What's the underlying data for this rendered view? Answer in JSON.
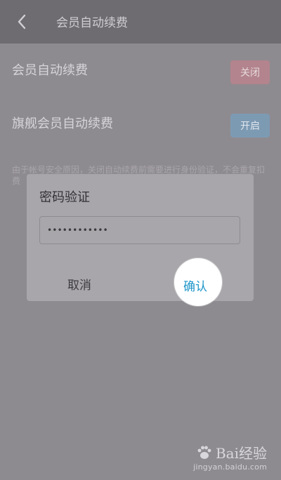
{
  "header": {
    "title": "会员自动续费",
    "back_icon": "chevron-left-icon"
  },
  "settings": [
    {
      "label": "会员自动续费",
      "toggle": "关闭",
      "state_color": "#b3848d"
    },
    {
      "label": "旗舰会员自动续费",
      "toggle": "开启",
      "state_color": "#7d9ab3"
    }
  ],
  "description": "由于帐号安全原因，关闭自动续费前需要进行身份验证，不会重复扣费",
  "dialog": {
    "title": "密码验证",
    "password_value": "••••••••••••",
    "cancel_label": "取消",
    "confirm_label": "确认",
    "confirm_color": "#1e96c9"
  },
  "watermark": {
    "brand": "Bai经验",
    "url": "jingyan.baidu.com"
  }
}
